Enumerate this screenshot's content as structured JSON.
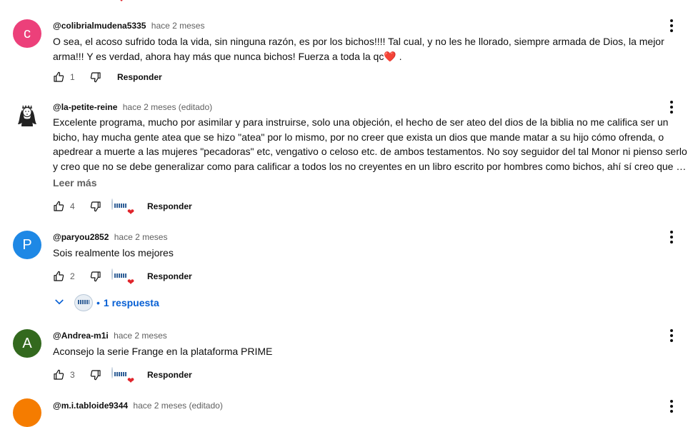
{
  "colors": {
    "link_blue": "#065fd4",
    "heart_red": "#e0242b",
    "meta_gray": "#606060"
  },
  "reply_label": "Responder",
  "read_more": "Leer más",
  "comments": [
    {
      "avatar": {
        "letter": "c",
        "color": "#ec407a"
      },
      "author": "@colibrialmudena5335",
      "time": "hace 2 meses",
      "text": "O sea, el acoso sufrido toda la vida, sin ninguna razón, es por los bichos!!!!  Tal cual, y no les he llorado, siempre armada de Dios, la mejor arma!!! Y es verdad, ahora hay más que nunca bichos! Fuerza a toda la qc❤️ .",
      "likes": "1",
      "creator_heart": false
    },
    {
      "avatar": {
        "icon": "queen-portrait"
      },
      "author": "@la-petite-reine",
      "time": "hace 2 meses (editado)",
      "text": "Excelente programa, mucho por asimilar y para instruirse, solo una objeción, el hecho de ser ateo del dios de la biblia no me califica ser un bicho, hay mucha gente atea que se hizo \"atea\" por lo mismo, por no creer que exista un dios que mande matar a su hijo cómo ofrenda, o apedrear a muerte a las mujeres \"pecadoras\" etc, vengativo o celoso etc. de ambos testamentos. No soy seguidor del tal Monor ni pienso serlo y creo que no se debe generalizar como para calificar a todos los no creyentes en un libro escrito por hombres como bichos, ahí sí creo que se equivocan.",
      "likes": "4",
      "creator_heart": true
    },
    {
      "avatar": {
        "letter": "P",
        "color": "#1e88e5"
      },
      "author": "@paryou2852",
      "time": "hace 2 meses",
      "text": "Sois realmente los mejores",
      "likes": "2",
      "creator_heart": true,
      "replies_label": "1 respuesta"
    },
    {
      "avatar": {
        "letter": "A",
        "color": "#33691e"
      },
      "author": "@Andrea-m1i",
      "time": "hace 2 meses",
      "text": "Aconsejo la serie Frange en la plataforma PRIME",
      "likes": "3",
      "creator_heart": true
    },
    {
      "avatar": {
        "letter": "",
        "color": "#f57c00"
      },
      "author": "@m.i.tabloide9344",
      "time": "hace 2 meses (editado)"
    }
  ]
}
